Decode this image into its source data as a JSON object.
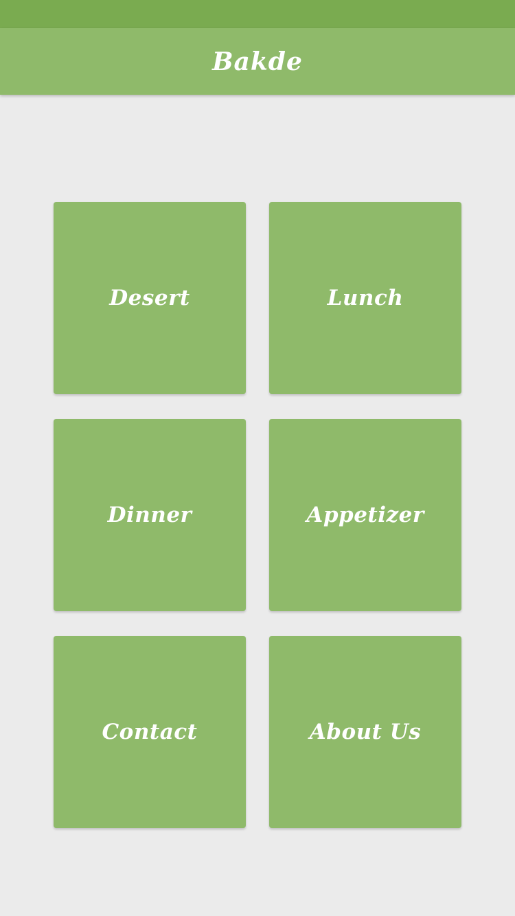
{
  "app": {
    "title": "Bakde"
  },
  "menu": {
    "tiles": [
      {
        "label": "Desert"
      },
      {
        "label": "Lunch"
      },
      {
        "label": "Dinner"
      },
      {
        "label": "Appetizer"
      },
      {
        "label": "Contact"
      },
      {
        "label": "About Us"
      }
    ]
  },
  "colors": {
    "status_bar": "#7aab50",
    "primary": "#8fba6a",
    "background": "#ebebeb",
    "text_on_primary": "#ffffff"
  }
}
